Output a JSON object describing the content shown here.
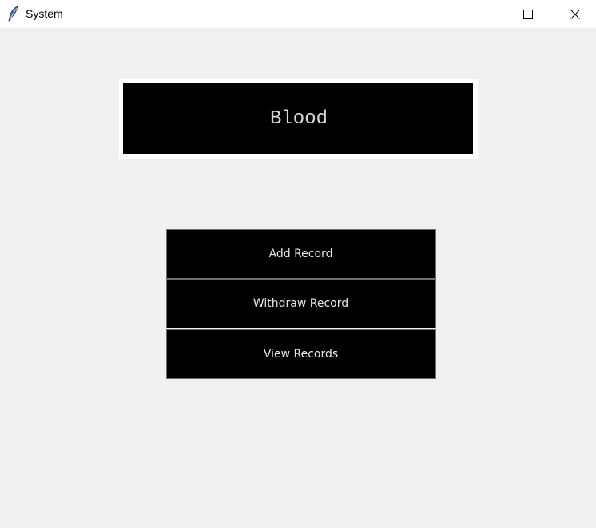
{
  "window": {
    "title": "System",
    "icon": "feather-icon",
    "controls": [
      "minimize-icon",
      "maximize-icon",
      "close-icon"
    ]
  },
  "header": {
    "label": "Blood"
  },
  "menu": {
    "add_label": "Add Record",
    "withdraw_label": "Withdraw Record",
    "view_label": "View Records"
  },
  "colors": {
    "background": "#f0f0f0",
    "button_bg": "#000000",
    "button_text": "#e8e8e8",
    "header_bg": "#000000",
    "header_border": "#ffffff"
  }
}
